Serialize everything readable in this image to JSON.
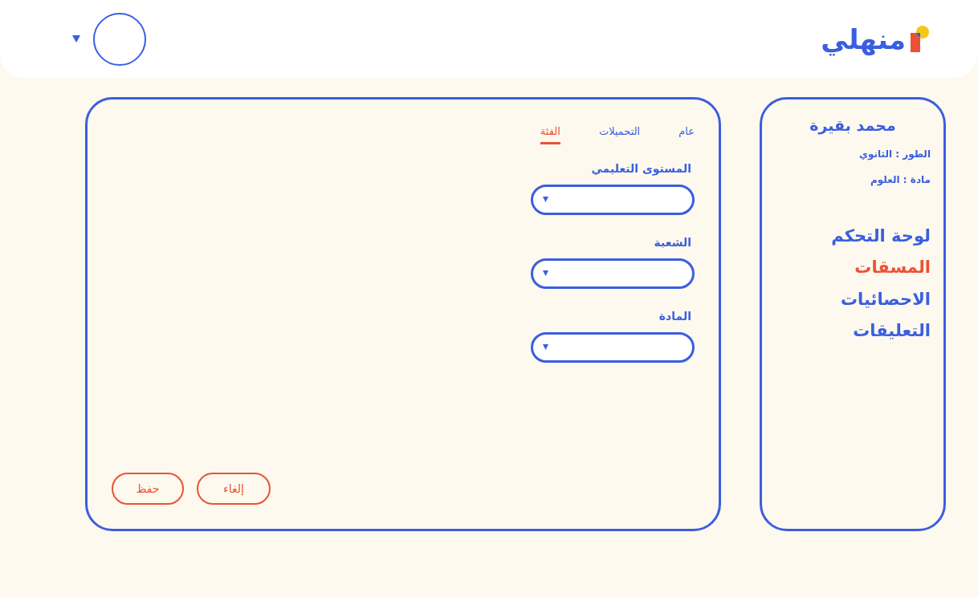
{
  "header": {
    "logo": "منهلي"
  },
  "profile": {
    "name": "محمد بقيرة",
    "details": [
      "الطور : الثانوي",
      "مادة : العلوم"
    ]
  },
  "sidebar": {
    "items": [
      {
        "label": "لوحة التحكم",
        "selected": false
      },
      {
        "label": "المسقات",
        "selected": true
      },
      {
        "label": "الاحصائيات",
        "selected": false
      },
      {
        "label": "التعليقات",
        "selected": false
      }
    ]
  },
  "tabs": [
    {
      "label": "عام",
      "selected": false
    },
    {
      "label": "التحميلات",
      "selected": false
    },
    {
      "label": "الفئة",
      "selected": true
    }
  ],
  "fields": [
    {
      "label": "المستوى التعليمي"
    },
    {
      "label": "الشعبة"
    },
    {
      "label": "المادة"
    }
  ],
  "buttons": [
    {
      "label": "إلغاء"
    },
    {
      "label": "حفظ"
    }
  ]
}
